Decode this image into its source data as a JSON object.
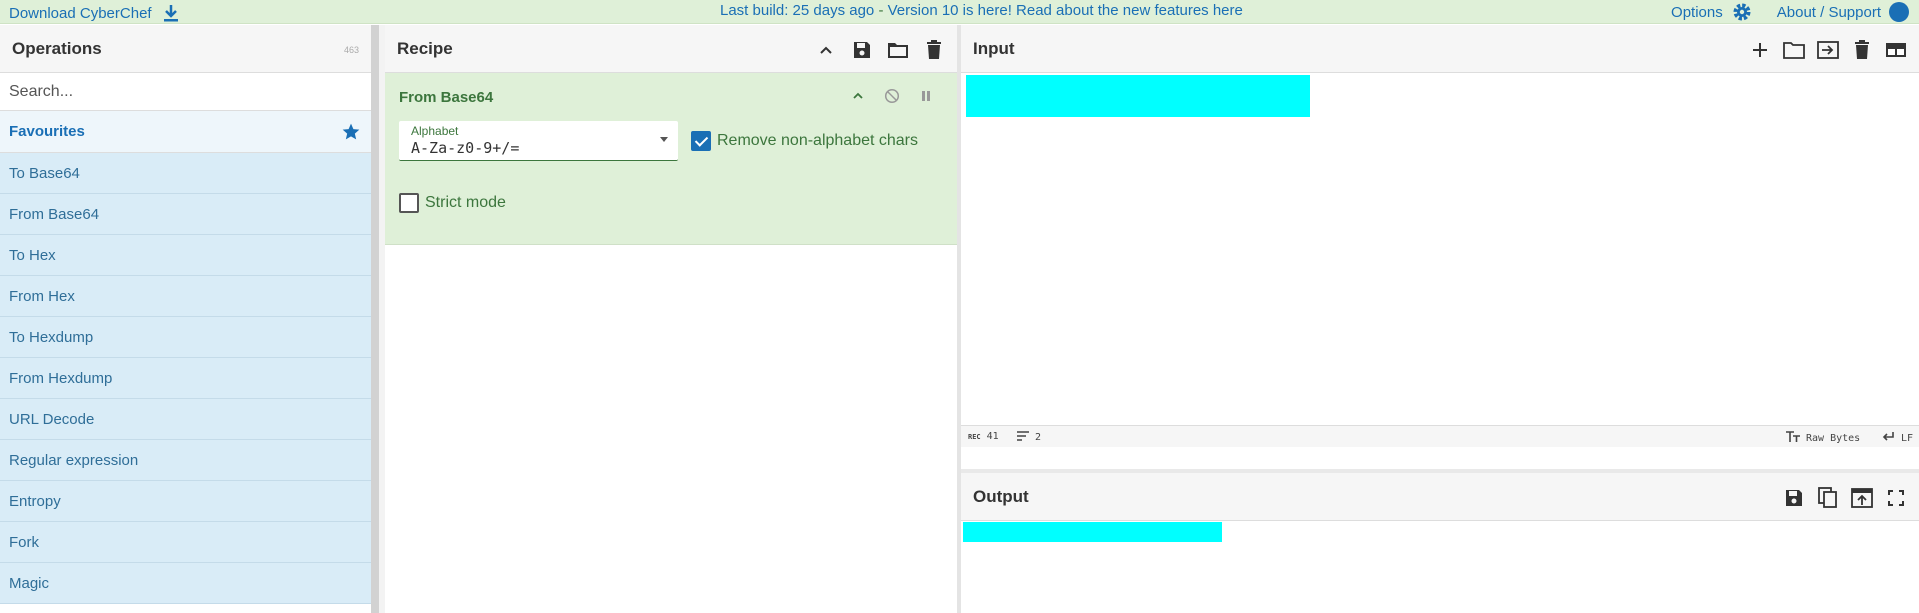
{
  "banner": {
    "download_label": "Download CyberChef",
    "build_text": "Last build: 25 days ago",
    "separator": " - ",
    "version_text": "Version 10 is here! Read about the new features ",
    "here_link": "here",
    "options_label": "Options",
    "about_label": "About / Support"
  },
  "operations": {
    "title": "Operations",
    "count": "463",
    "search_placeholder": "Search...",
    "favourites_label": "Favourites",
    "items": [
      "To Base64",
      "From Base64",
      "To Hex",
      "From Hex",
      "To Hexdump",
      "From Hexdump",
      "URL Decode",
      "Regular expression",
      "Entropy",
      "Fork",
      "Magic"
    ]
  },
  "recipe": {
    "title": "Recipe",
    "ingredient": {
      "title": "From Base64",
      "alphabet_label": "Alphabet",
      "alphabet_value": "A-Za-z0-9+/=",
      "remove_non_alphabet_label": "Remove non-alphabet chars",
      "remove_non_alphabet_checked": true,
      "strict_mode_label": "Strict mode",
      "strict_mode_checked": false
    }
  },
  "input": {
    "title": "Input",
    "stats": {
      "rec_label": "REC",
      "length": "41",
      "lines": "2",
      "encoding": "Raw Bytes",
      "eol": "LF"
    }
  },
  "output": {
    "title": "Output"
  },
  "colors": {
    "accent": "#1a6fb5",
    "recipe_bg": "#dff0d8",
    "op_bg": "#d9ecf7",
    "highlight": "#00ffff"
  }
}
